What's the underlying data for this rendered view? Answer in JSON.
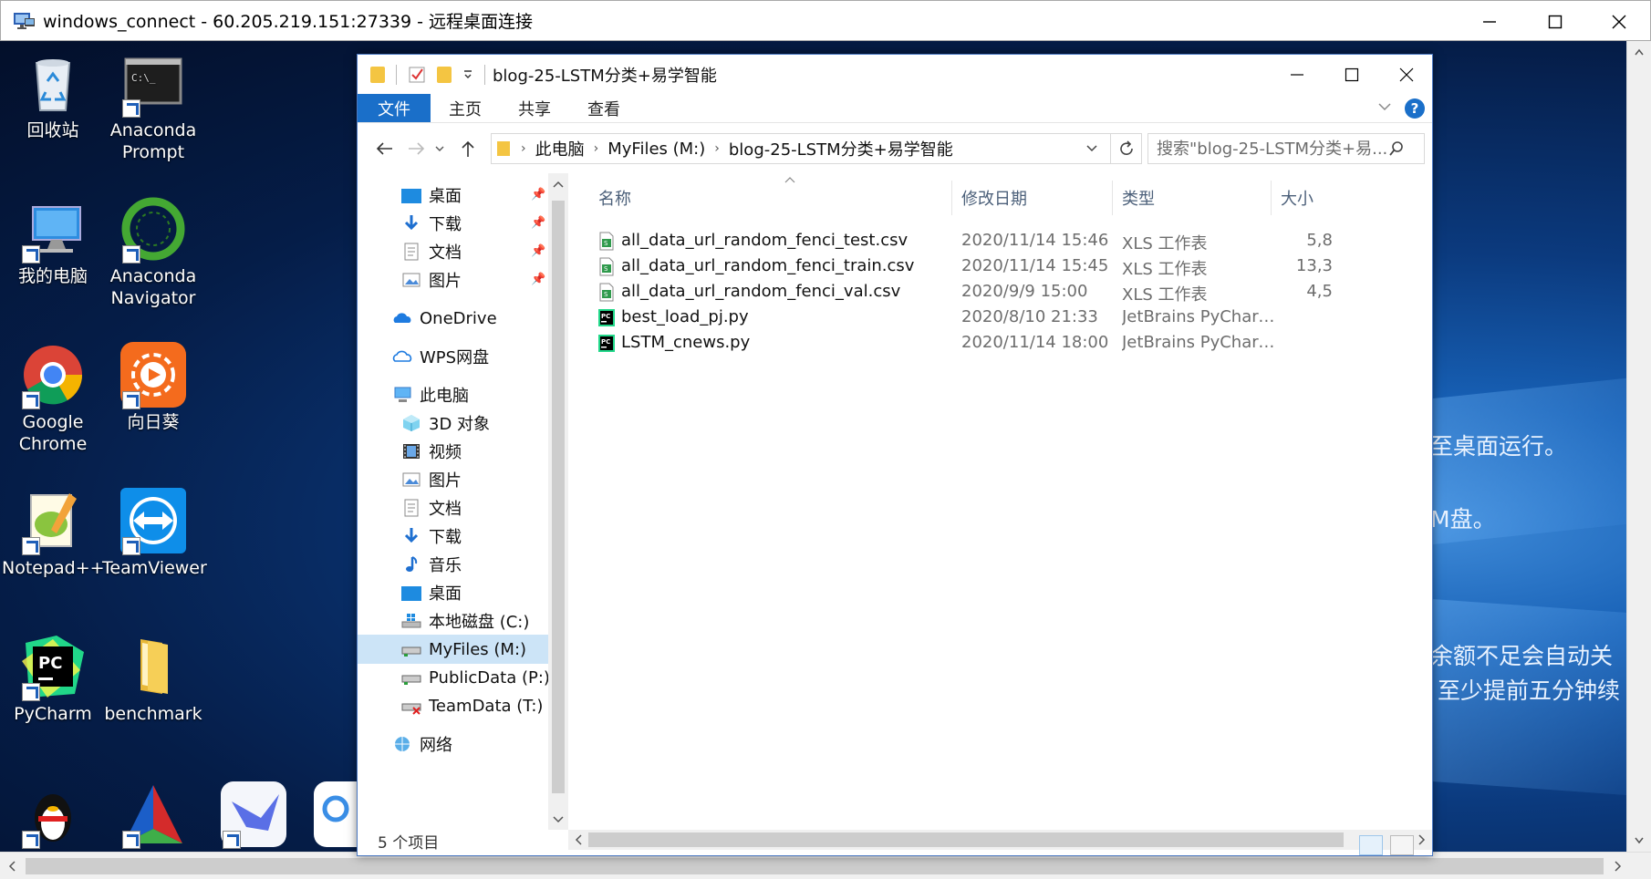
{
  "rdp": {
    "title": "windows_connect - 60.205.219.151:27339 - 远程桌面连接"
  },
  "desktop": {
    "icons": [
      {
        "label": "回收站"
      },
      {
        "label": "Anaconda Prompt"
      },
      {
        "label": "我的电脑"
      },
      {
        "label": "Anaconda Navigator"
      },
      {
        "label": "Google Chrome"
      },
      {
        "label": "向日葵"
      },
      {
        "label": "Notepad++"
      },
      {
        "label": "TeamViewer"
      },
      {
        "label": "PyCharm"
      },
      {
        "label": "benchmark"
      }
    ],
    "messages": [
      "至桌面运行。",
      "M盘。",
      "余额不足会自动关",
      "至少提前五分钟续"
    ]
  },
  "explorer": {
    "title": "blog-25-LSTM分类+易学智能",
    "ribbon_tabs": [
      "文件",
      "主页",
      "共享",
      "查看"
    ],
    "address": [
      "此电脑",
      "MyFiles (M:)",
      "blog-25-LSTM分类+易学智能"
    ],
    "search_placeholder": "搜索\"blog-25-LSTM分类+易...",
    "nav": [
      {
        "label": "桌面",
        "pinned": true
      },
      {
        "label": "下载",
        "pinned": true
      },
      {
        "label": "文档",
        "pinned": true
      },
      {
        "label": "图片",
        "pinned": true
      },
      {
        "label": "OneDrive"
      },
      {
        "label": "WPS网盘"
      },
      {
        "label": "此电脑"
      },
      {
        "label": "3D 对象"
      },
      {
        "label": "视频"
      },
      {
        "label": "图片"
      },
      {
        "label": "文档"
      },
      {
        "label": "下载"
      },
      {
        "label": "音乐"
      },
      {
        "label": "桌面"
      },
      {
        "label": "本地磁盘 (C:)"
      },
      {
        "label": "MyFiles (M:)",
        "selected": true
      },
      {
        "label": "PublicData (P:)"
      },
      {
        "label": "TeamData (T:)"
      },
      {
        "label": "网络"
      }
    ],
    "columns": [
      "名称",
      "修改日期",
      "类型",
      "大小"
    ],
    "files": [
      {
        "name": "all_data_url_random_fenci_test.csv",
        "date": "2020/11/14 15:46",
        "type": "XLS 工作表",
        "size": "5,8"
      },
      {
        "name": "all_data_url_random_fenci_train.csv",
        "date": "2020/11/14 15:45",
        "type": "XLS 工作表",
        "size": "13,3"
      },
      {
        "name": "all_data_url_random_fenci_val.csv",
        "date": "2020/9/9 15:00",
        "type": "XLS 工作表",
        "size": "4,5"
      },
      {
        "name": "best_load_pj.py",
        "date": "2020/8/10 21:33",
        "type": "JetBrains PyCharm ...",
        "size": ""
      },
      {
        "name": "LSTM_cnews.py",
        "date": "2020/11/14 18:00",
        "type": "JetBrains PyCharm ...",
        "size": ""
      }
    ],
    "status": "5 个项目"
  },
  "colors": {
    "accent": "#1a6fc9",
    "selected": "#cce4f7"
  }
}
